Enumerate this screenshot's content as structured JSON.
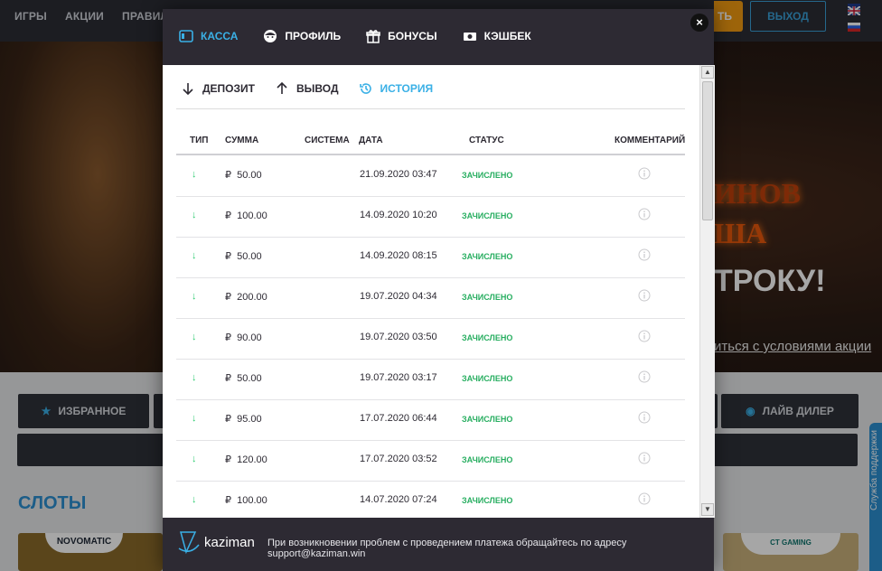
{
  "site": {
    "nav": [
      "ИГРЫ",
      "АКЦИИ",
      "ПРАВИЛА"
    ],
    "cash_button": "ТЬ",
    "logout_button": "ВЫХОД",
    "hero_line1": "ИНОВ",
    "hero_line2": "ША",
    "hero_line3": "ТРОКУ!",
    "hero_link": "иться с условиями акции",
    "categories": {
      "favorites": "ИЗБРАННОЕ",
      "live_dealer": "ЛАЙВ ДИЛЕР"
    },
    "slots_title": "СЛОТЫ",
    "providers": [
      "NOVOMATIC",
      "CT GAMING"
    ],
    "support_tab": "Служба поддержки"
  },
  "modal": {
    "close": "×",
    "tabs": [
      {
        "label": "КАССА",
        "icon": "wallet-icon",
        "active": true
      },
      {
        "label": "ПРОФИЛЬ",
        "icon": "face-icon",
        "active": false
      },
      {
        "label": "БОНУСЫ",
        "icon": "gift-icon",
        "active": false
      },
      {
        "label": "КЭШБЕК",
        "icon": "cash-icon",
        "active": false
      }
    ],
    "subtabs": [
      {
        "label": "ДЕПОЗИТ",
        "icon": "arrow-down-icon",
        "active": false
      },
      {
        "label": "ВЫВОД",
        "icon": "arrow-up-icon",
        "active": false
      },
      {
        "label": "ИСТОРИЯ",
        "icon": "history-icon",
        "active": true
      }
    ],
    "table": {
      "headers": {
        "type": "ТИП",
        "amount": "СУММА",
        "system": "СИСТЕМА",
        "date": "ДАТА",
        "status": "СТАТУС",
        "comment": "КОММЕНТАРИЙ"
      },
      "currency": "₽",
      "rows": [
        {
          "type": "↓",
          "amount": "50.00",
          "date": "21.09.2020 03:47",
          "status": "ЗАЧИСЛЕНО"
        },
        {
          "type": "↓",
          "amount": "100.00",
          "date": "14.09.2020 10:20",
          "status": "ЗАЧИСЛЕНО"
        },
        {
          "type": "↓",
          "amount": "50.00",
          "date": "14.09.2020 08:15",
          "status": "ЗАЧИСЛЕНО"
        },
        {
          "type": "↓",
          "amount": "200.00",
          "date": "19.07.2020 04:34",
          "status": "ЗАЧИСЛЕНО"
        },
        {
          "type": "↓",
          "amount": "90.00",
          "date": "19.07.2020 03:50",
          "status": "ЗАЧИСЛЕНО"
        },
        {
          "type": "↓",
          "amount": "50.00",
          "date": "19.07.2020 03:17",
          "status": "ЗАЧИСЛЕНО"
        },
        {
          "type": "↓",
          "amount": "95.00",
          "date": "17.07.2020 06:44",
          "status": "ЗАЧИСЛЕНО"
        },
        {
          "type": "↓",
          "amount": "120.00",
          "date": "17.07.2020 03:52",
          "status": "ЗАЧИСЛЕНО"
        },
        {
          "type": "↓",
          "amount": "100.00",
          "date": "14.07.2020 07:24",
          "status": "ЗАЧИСЛЕНО"
        }
      ]
    },
    "footer": {
      "logo": "kaziman",
      "text": "При возникновении проблем с проведением платежа обращайтесь по адресу support@kaziman.win"
    }
  },
  "colors": {
    "accent": "#3ab0e6",
    "success": "#27ae60",
    "dark": "#2d2a33",
    "orange": "#f39c12"
  }
}
